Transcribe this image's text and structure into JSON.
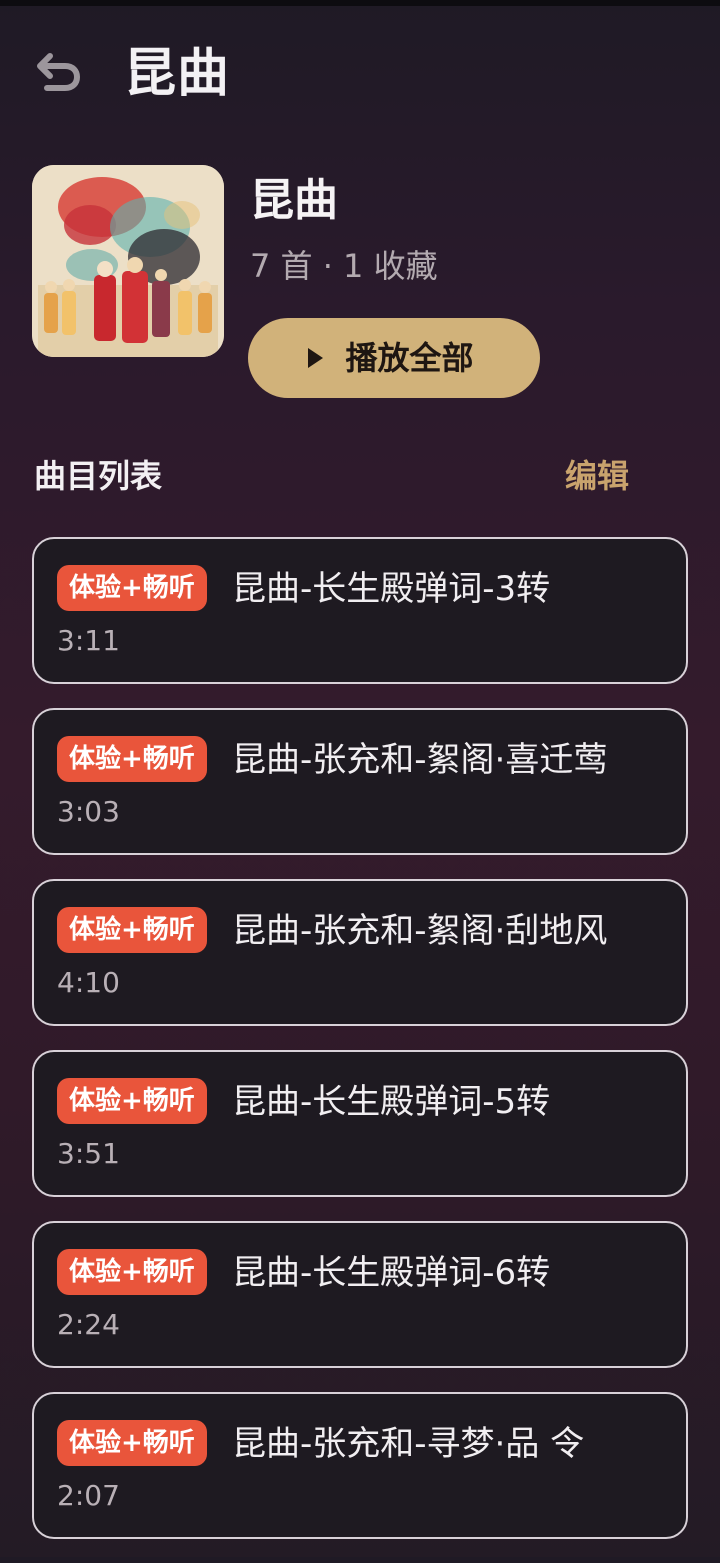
{
  "header": {
    "title": "昆曲",
    "back_icon": "undo-back-icon"
  },
  "album": {
    "name": "昆曲",
    "meta": "7 首 · 1 收藏",
    "play_all_label": "播放全部",
    "play_icon": "play-triangle-icon"
  },
  "list": {
    "title": "曲目列表",
    "edit_label": "编辑",
    "tracks": [
      {
        "badge": "体验+畅听",
        "title": "昆曲-长生殿弹词-3转",
        "duration": "3:11"
      },
      {
        "badge": "体验+畅听",
        "title": "昆曲-张充和-絮阁·喜迁莺",
        "duration": "3:03"
      },
      {
        "badge": "体验+畅听",
        "title": "昆曲-张充和-絮阁·刮地风",
        "duration": "4:10"
      },
      {
        "badge": "体验+畅听",
        "title": "昆曲-长生殿弹词-5转",
        "duration": "3:51"
      },
      {
        "badge": "体验+畅听",
        "title": "昆曲-长生殿弹词-6转",
        "duration": "2:24"
      },
      {
        "badge": "体验+畅听",
        "title": "昆曲-张充和-寻梦·品 令",
        "duration": "2:07"
      }
    ]
  },
  "colors": {
    "accent_gold": "#d1b27a",
    "edit_gold": "#c9a36d",
    "badge_red": "#e9553b",
    "card_bg": "#1e1a21"
  }
}
